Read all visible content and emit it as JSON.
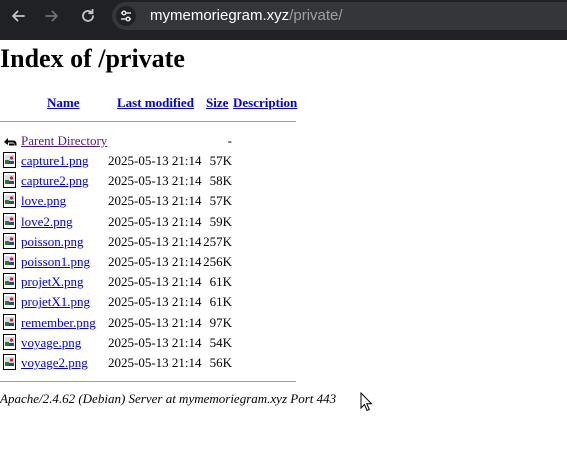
{
  "browser": {
    "url_host": "mymemoriegram.xyz",
    "url_path": "/private/"
  },
  "page": {
    "title": "Index of /private",
    "columns": {
      "name": "Name",
      "last_modified": "Last modified",
      "size": "Size",
      "description": "Description"
    },
    "parent": {
      "name": "Parent Directory",
      "size": "-"
    },
    "files": [
      {
        "name": "capture1.png",
        "modified": "2025-05-13 21:14",
        "size": "57K"
      },
      {
        "name": "capture2.png",
        "modified": "2025-05-13 21:14",
        "size": "58K"
      },
      {
        "name": "love.png",
        "modified": "2025-05-13 21:14",
        "size": "57K"
      },
      {
        "name": "love2.png",
        "modified": "2025-05-13 21:14",
        "size": "59K"
      },
      {
        "name": "poisson.png",
        "modified": "2025-05-13 21:14",
        "size": "257K"
      },
      {
        "name": "poisson1.png",
        "modified": "2025-05-13 21:14",
        "size": "256K"
      },
      {
        "name": "projetX.png",
        "modified": "2025-05-13 21:14",
        "size": "61K"
      },
      {
        "name": "projetX1.png",
        "modified": "2025-05-13 21:14",
        "size": "61K"
      },
      {
        "name": "remember.png",
        "modified": "2025-05-13 21:14",
        "size": "97K"
      },
      {
        "name": "voyage.png",
        "modified": "2025-05-13 21:14",
        "size": "54K"
      },
      {
        "name": "voyage2.png",
        "modified": "2025-05-13 21:14",
        "size": "56K"
      }
    ],
    "server_signature": "Apache/2.4.62 (Debian) Server at mymemoriegram.xyz Port 443"
  }
}
